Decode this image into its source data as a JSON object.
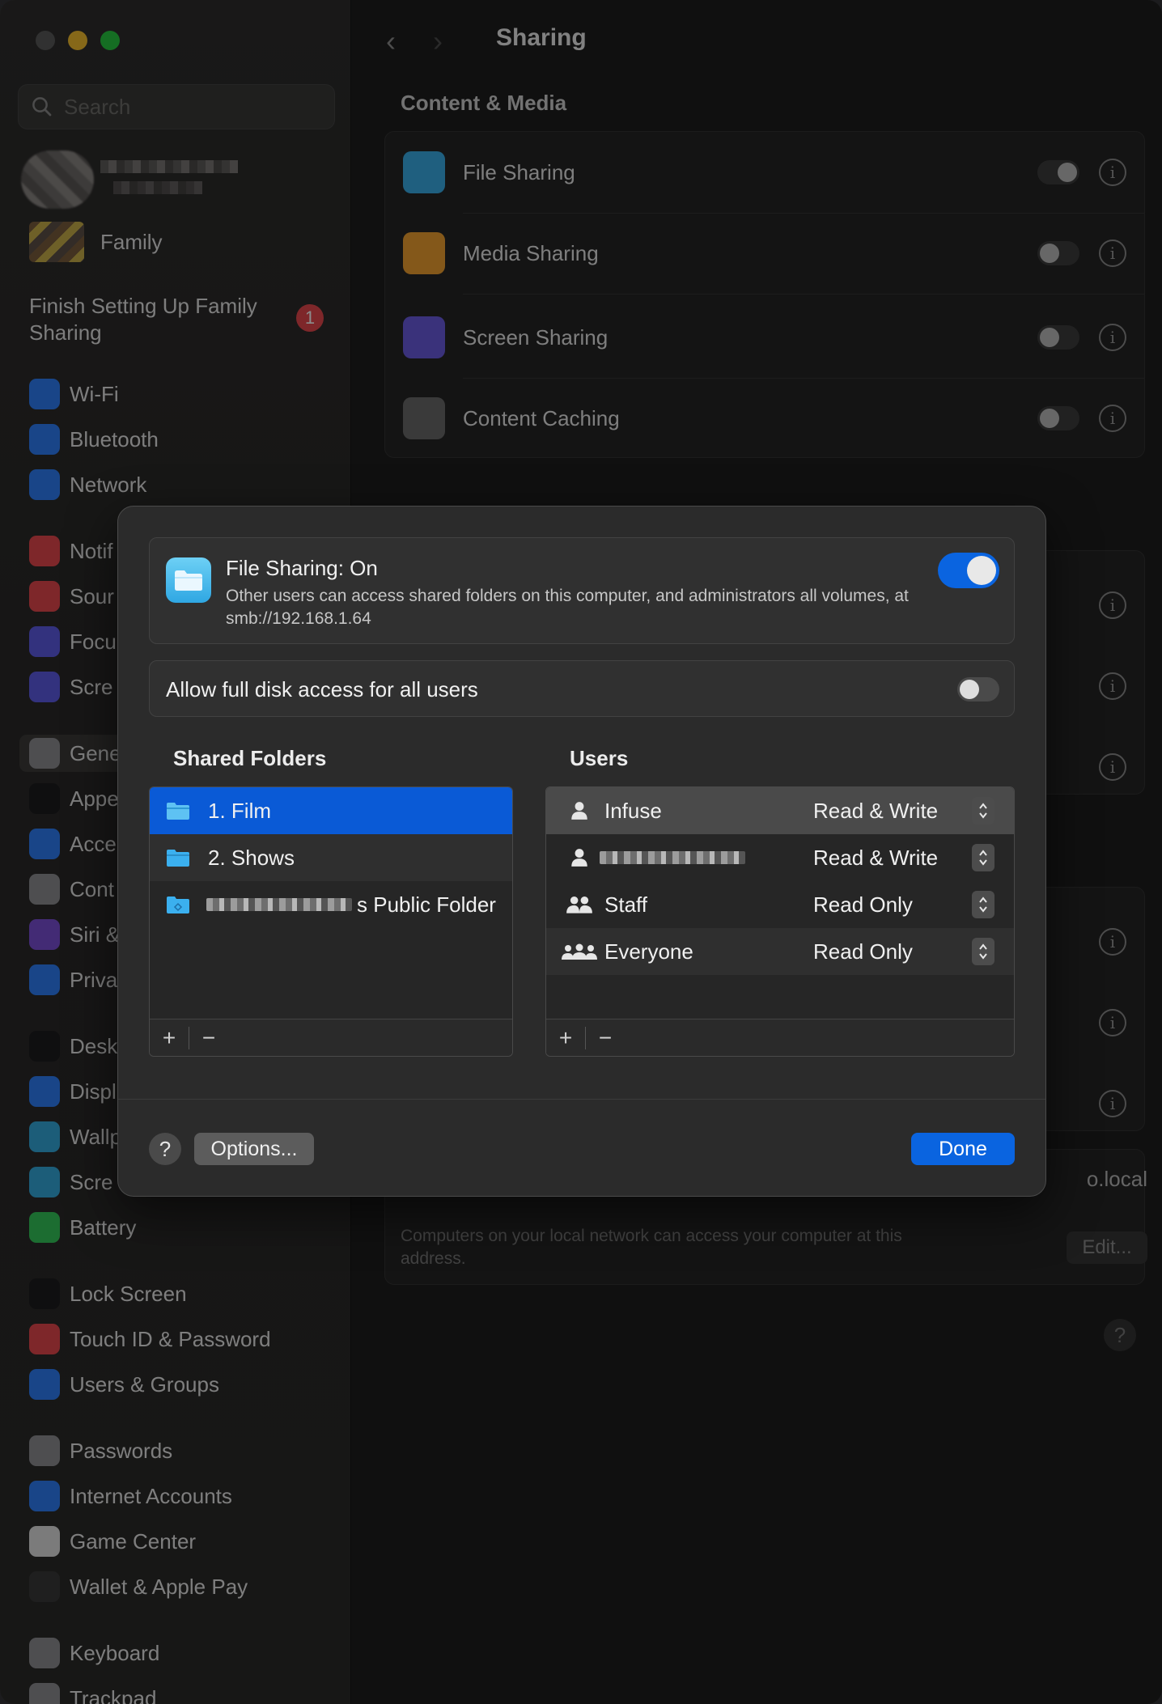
{
  "sidebar": {
    "search_placeholder": "Search",
    "family_label": "Family",
    "finish_setup": "Finish Setting Up Family Sharing",
    "finish_badge": "1",
    "items": [
      {
        "label": "Wi-Fi",
        "icon": "wifi-icon",
        "color": "#2f7ff7"
      },
      {
        "label": "Bluetooth",
        "icon": "bluetooth-icon",
        "color": "#2f7ff7"
      },
      {
        "label": "Network",
        "icon": "globe-icon",
        "color": "#2f7ff7"
      },
      {
        "label": "Notif",
        "icon": "bell-icon",
        "color": "#e5484d"
      },
      {
        "label": "Sour",
        "icon": "speaker-icon",
        "color": "#e5484d"
      },
      {
        "label": "Focu",
        "icon": "moon-icon",
        "color": "#5e5ce6"
      },
      {
        "label": "Scre",
        "icon": "hourglass-icon",
        "color": "#5e5ce6"
      },
      {
        "label": "Gene",
        "icon": "gear-icon",
        "color": "#8e8e93"
      },
      {
        "label": "Appe",
        "icon": "appearance-icon",
        "color": "#1c1c1e"
      },
      {
        "label": "Acce",
        "icon": "accessibility-icon",
        "color": "#2f7ff7"
      },
      {
        "label": "Cont",
        "icon": "control-center-icon",
        "color": "#8e8e93"
      },
      {
        "label": "Siri &",
        "icon": "siri-icon",
        "color": "#7b4fd6"
      },
      {
        "label": "Priva",
        "icon": "hand-icon",
        "color": "#2f7ff7"
      },
      {
        "label": "Desk",
        "icon": "desktop-icon",
        "color": "#1c1c1e"
      },
      {
        "label": "Displ",
        "icon": "sun-icon",
        "color": "#2f7ff7"
      },
      {
        "label": "Wallp",
        "icon": "flower-icon",
        "color": "#34aadc"
      },
      {
        "label": "Scre",
        "icon": "screensaver-icon",
        "color": "#34aadc"
      },
      {
        "label": "Battery",
        "icon": "battery-icon",
        "color": "#34c759"
      },
      {
        "label": "Lock Screen",
        "icon": "lock-icon",
        "color": "#1c1c1e"
      },
      {
        "label": "Touch ID & Password",
        "icon": "fingerprint-icon",
        "color": "#e5484d"
      },
      {
        "label": "Users & Groups",
        "icon": "users-icon",
        "color": "#2f7ff7"
      },
      {
        "label": "Passwords",
        "icon": "key-icon",
        "color": "#8e8e93"
      },
      {
        "label": "Internet Accounts",
        "icon": "at-icon",
        "color": "#2f7ff7"
      },
      {
        "label": "Game Center",
        "icon": "game-center-icon",
        "color": "#e0e0e0"
      },
      {
        "label": "Wallet & Apple Pay",
        "icon": "wallet-icon",
        "color": "#3a3a3a"
      },
      {
        "label": "Keyboard",
        "icon": "keyboard-icon",
        "color": "#8e8e93"
      },
      {
        "label": "Trackpad",
        "icon": "trackpad-icon",
        "color": "#8e8e93"
      }
    ]
  },
  "main": {
    "title": "Sharing",
    "section_title": "Content & Media",
    "services": [
      {
        "label": "File Sharing",
        "icon": "folder-icon",
        "color": "#3aaee8",
        "on": true
      },
      {
        "label": "Media Sharing",
        "icon": "music-icon",
        "color": "#f0a030",
        "on": false
      },
      {
        "label": "Screen Sharing",
        "icon": "screen-sharing-icon",
        "color": "#6a5ce0",
        "on": false
      },
      {
        "label": "Content Caching",
        "icon": "download-icon",
        "color": "#6a6a6a",
        "on": false
      }
    ],
    "hostname_suffix": "o.local",
    "local_desc": "Computers on your local network can access your computer at this address.",
    "edit_label": "Edit...",
    "help": "?"
  },
  "sheet": {
    "file_sharing_title": "File Sharing: On",
    "file_sharing_desc": "Other users can access shared folders on this computer, and administrators all volumes, at smb://192.168.1.64",
    "file_sharing_on": true,
    "disk_access_label": "Allow full disk access for all users",
    "disk_access_on": false,
    "shared_folders_header": "Shared Folders",
    "users_header": "Users",
    "folders": [
      {
        "label": "1. Film",
        "selected": true
      },
      {
        "label": "2. Shows",
        "selected": false
      },
      {
        "label": "s Public Folder",
        "selected": false
      }
    ],
    "users": [
      {
        "name": "Infuse",
        "permission": "Read & Write",
        "icon": "user-icon"
      },
      {
        "name": "",
        "permission": "Read & Write",
        "icon": "user-icon"
      },
      {
        "name": "Staff",
        "permission": "Read Only",
        "icon": "group-icon"
      },
      {
        "name": "Everyone",
        "permission": "Read Only",
        "icon": "everyone-icon"
      }
    ],
    "add": "+",
    "remove": "−",
    "help": "?",
    "options_label": "Options...",
    "done_label": "Done"
  }
}
